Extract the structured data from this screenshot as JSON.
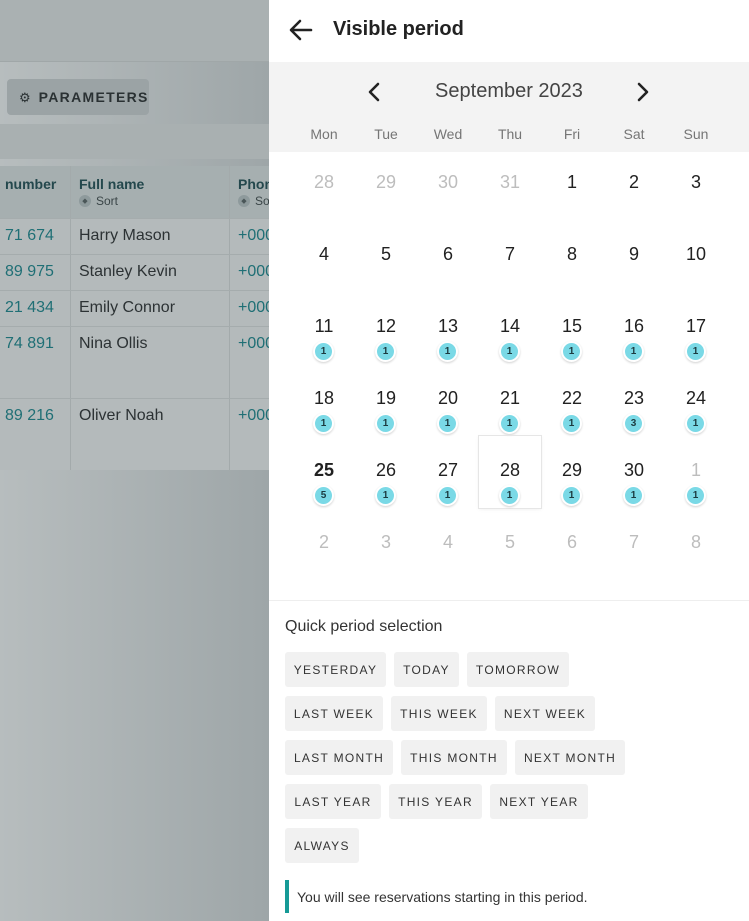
{
  "background": {
    "parameters_label": "PARAMETERS",
    "gear_icon": "gear-icon",
    "columns": [
      {
        "label": "number"
      },
      {
        "label": "Full name",
        "sort": "Sort"
      },
      {
        "label": "Phon",
        "sort": "So"
      }
    ],
    "rows": [
      {
        "number": "71 674",
        "name": "Harry Mason",
        "phone": "+000"
      },
      {
        "number": "89 975",
        "name": "Stanley Kevin",
        "phone": "+000"
      },
      {
        "number": "21 434",
        "name": "Emily Connor",
        "phone": "+000"
      },
      {
        "number": "74 891",
        "name": "Nina Ollis",
        "phone": "+000"
      },
      {
        "number": "89 216",
        "name": "Oliver Noah",
        "phone": "+000"
      }
    ]
  },
  "drawer": {
    "title": "Visible period",
    "back_icon": "arrow-left-icon"
  },
  "calendar": {
    "month_label": "September 2023",
    "prev_icon": "chevron-left-icon",
    "next_icon": "chevron-right-icon",
    "weekdays": [
      "Mon",
      "Tue",
      "Wed",
      "Thu",
      "Fri",
      "Sat",
      "Sun"
    ],
    "weeks": [
      [
        {
          "d": "28",
          "muted": true
        },
        {
          "d": "29",
          "muted": true
        },
        {
          "d": "30",
          "muted": true
        },
        {
          "d": "31",
          "muted": true
        },
        {
          "d": "1"
        },
        {
          "d": "2"
        },
        {
          "d": "3"
        }
      ],
      [
        {
          "d": "4"
        },
        {
          "d": "5"
        },
        {
          "d": "6"
        },
        {
          "d": "7"
        },
        {
          "d": "8"
        },
        {
          "d": "9"
        },
        {
          "d": "10"
        }
      ],
      [
        {
          "d": "11",
          "badge": "1"
        },
        {
          "d": "12",
          "badge": "1"
        },
        {
          "d": "13",
          "badge": "1"
        },
        {
          "d": "14",
          "badge": "1"
        },
        {
          "d": "15",
          "badge": "1"
        },
        {
          "d": "16",
          "badge": "1"
        },
        {
          "d": "17",
          "badge": "1"
        }
      ],
      [
        {
          "d": "18",
          "badge": "1"
        },
        {
          "d": "19",
          "badge": "1"
        },
        {
          "d": "20",
          "badge": "1"
        },
        {
          "d": "21",
          "badge": "1"
        },
        {
          "d": "22",
          "badge": "1"
        },
        {
          "d": "23",
          "badge": "3"
        },
        {
          "d": "24",
          "badge": "1"
        }
      ],
      [
        {
          "d": "25",
          "badge": "5",
          "bold": true
        },
        {
          "d": "26",
          "badge": "1"
        },
        {
          "d": "27",
          "badge": "1"
        },
        {
          "d": "28",
          "badge": "1",
          "outlined": true
        },
        {
          "d": "29",
          "badge": "1"
        },
        {
          "d": "30",
          "badge": "1"
        },
        {
          "d": "1",
          "badge": "1",
          "muted": true
        }
      ],
      [
        {
          "d": "2",
          "muted": true
        },
        {
          "d": "3",
          "muted": true
        },
        {
          "d": "4",
          "muted": true
        },
        {
          "d": "5",
          "muted": true
        },
        {
          "d": "6",
          "muted": true
        },
        {
          "d": "7",
          "muted": true
        },
        {
          "d": "8",
          "muted": true
        }
      ]
    ]
  },
  "quick": {
    "title": "Quick period selection",
    "rows": [
      [
        "YESTERDAY",
        "TODAY",
        "TOMORROW"
      ],
      [
        "LAST WEEK",
        "THIS WEEK",
        "NEXT WEEK"
      ],
      [
        "LAST MONTH",
        "THIS MONTH",
        "NEXT MONTH"
      ],
      [
        "LAST YEAR",
        "THIS YEAR",
        "NEXT YEAR"
      ],
      [
        "ALWAYS"
      ]
    ]
  },
  "note": "You will see reservations starting in this period.",
  "colors": {
    "accent": "#169a96",
    "badge": "#7ad9e6"
  }
}
